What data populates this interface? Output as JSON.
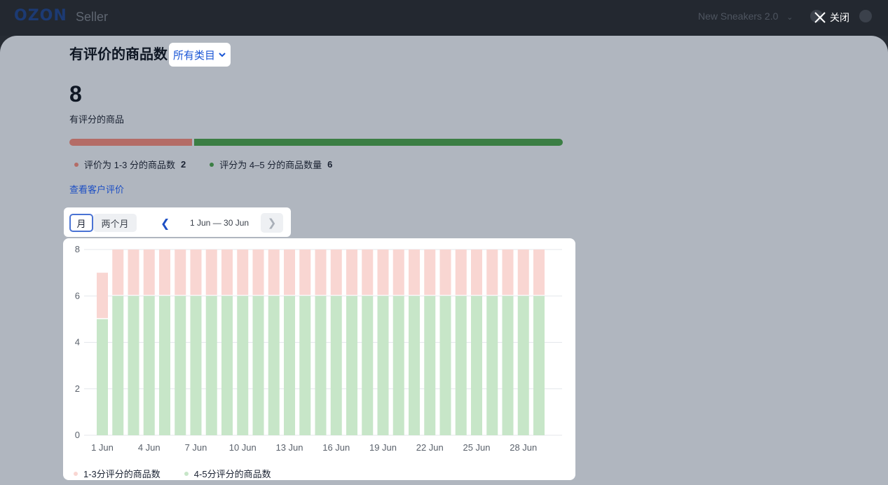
{
  "header": {
    "logo": "OZON",
    "logo_suffix": "Seller",
    "store_name": "New Sneakers 2.0",
    "close_label": "关闭"
  },
  "panel": {
    "title": "有评价的商品数",
    "category_select": "所有类目",
    "total": "8",
    "total_caption": "有评分的商品",
    "ratio": {
      "low_label": "评价为 1-3 分的商品数",
      "low_value": "2",
      "high_label": "评分为 4–5 分的商品数量",
      "high_value": "6",
      "low_color": "#b46c66",
      "high_color": "#3b7e44"
    },
    "reviews_link": "查看客户评价",
    "period": {
      "month": "月",
      "two_months": "两个月",
      "range": "1 Jun — 30 Jun"
    }
  },
  "chart_data": {
    "type": "bar",
    "stacked": true,
    "categories": [
      "1 Jun",
      "2 Jun",
      "3 Jun",
      "4 Jun",
      "5 Jun",
      "6 Jun",
      "7 Jun",
      "8 Jun",
      "9 Jun",
      "10 Jun",
      "11 Jun",
      "12 Jun",
      "13 Jun",
      "14 Jun",
      "15 Jun",
      "16 Jun",
      "17 Jun",
      "18 Jun",
      "19 Jun",
      "20 Jun",
      "21 Jun",
      "22 Jun",
      "23 Jun",
      "24 Jun",
      "25 Jun",
      "26 Jun",
      "27 Jun",
      "28 Jun",
      "29 Jun"
    ],
    "x_tick_labels": [
      "1 Jun",
      "4 Jun",
      "7 Jun",
      "10 Jun",
      "13 Jun",
      "16 Jun",
      "19 Jun",
      "22 Jun",
      "25 Jun",
      "28 Jun"
    ],
    "y_ticks": [
      0,
      2,
      4,
      6,
      8
    ],
    "ylim": [
      0,
      8
    ],
    "grid": true,
    "legend_position": "bottom-left",
    "series": [
      {
        "name": "4-5分评分的商品数",
        "color": "#c7e6c8",
        "values": [
          5,
          6,
          6,
          6,
          6,
          6,
          6,
          6,
          6,
          6,
          6,
          6,
          6,
          6,
          6,
          6,
          6,
          6,
          6,
          6,
          6,
          6,
          6,
          6,
          6,
          6,
          6,
          6,
          6
        ]
      },
      {
        "name": "1-3分评分的商品数",
        "color": "#f9d6d2",
        "values": [
          2,
          2,
          2,
          2,
          2,
          2,
          2,
          2,
          2,
          2,
          2,
          2,
          2,
          2,
          2,
          2,
          2,
          2,
          2,
          2,
          2,
          2,
          2,
          2,
          2,
          2,
          2,
          2,
          2
        ]
      }
    ],
    "legend_order": [
      "1-3分评分的商品数",
      "4-5分评分的商品数"
    ]
  }
}
